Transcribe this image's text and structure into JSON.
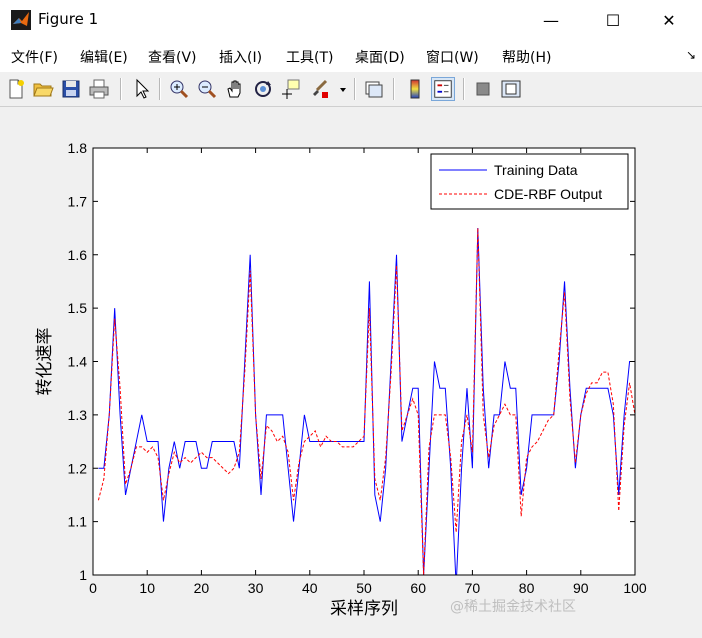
{
  "window": {
    "title": "Figure 1",
    "minimize_glyph": "—",
    "maximize_glyph": "☐",
    "close_glyph": "✕"
  },
  "menu": {
    "items": [
      "文件(F)",
      "编辑(E)",
      "查看(V)",
      "插入(I)",
      "工具(T)",
      "桌面(D)",
      "窗口(W)",
      "帮助(H)"
    ],
    "overflow_glyph": "↘"
  },
  "toolbar": {
    "icons": [
      "new-file-icon",
      "open-folder-icon",
      "save-icon",
      "print-icon",
      "pointer-icon",
      "zoom-in-icon",
      "zoom-out-icon",
      "pan-hand-icon",
      "rotate-3d-icon",
      "data-cursor-icon",
      "brush-icon",
      "brush-dropdown-icon",
      "link-plot-icon",
      "colorbar-icon",
      "legend-icon",
      "hide-plot-tools-icon",
      "show-plot-tools-icon"
    ]
  },
  "watermark": "@稀土掘金技术社区",
  "chart_data": {
    "type": "line",
    "title": "",
    "xlabel": "采样序列",
    "ylabel": "转化速率",
    "xlim": [
      0,
      100
    ],
    "ylim": [
      1,
      1.8
    ],
    "xticks": [
      0,
      10,
      20,
      30,
      40,
      50,
      60,
      70,
      80,
      90,
      100
    ],
    "yticks": [
      1,
      1.1,
      1.2,
      1.3,
      1.4,
      1.5,
      1.6,
      1.7,
      1.8
    ],
    "grid": false,
    "legend_position": "top-right",
    "series": [
      {
        "name": "Training Data",
        "color": "#0000ff",
        "style": "solid",
        "x": [
          1,
          2,
          3,
          4,
          5,
          6,
          7,
          8,
          9,
          10,
          11,
          12,
          13,
          14,
          15,
          16,
          17,
          18,
          19,
          20,
          21,
          22,
          23,
          24,
          25,
          26,
          27,
          28,
          29,
          30,
          31,
          32,
          33,
          34,
          35,
          36,
          37,
          38,
          39,
          40,
          41,
          42,
          43,
          44,
          45,
          46,
          47,
          48,
          49,
          50,
          51,
          52,
          53,
          54,
          55,
          56,
          57,
          58,
          59,
          60,
          61,
          62,
          63,
          64,
          65,
          66,
          67,
          68,
          69,
          70,
          71,
          72,
          73,
          74,
          75,
          76,
          77,
          78,
          79,
          80,
          81,
          82,
          83,
          84,
          85,
          86,
          87,
          88,
          89,
          90,
          91,
          92,
          93,
          94,
          95,
          96,
          97,
          98,
          99,
          100
        ],
        "y": [
          1.2,
          1.2,
          1.3,
          1.5,
          1.3,
          1.15,
          1.2,
          1.25,
          1.3,
          1.25,
          1.25,
          1.25,
          1.1,
          1.2,
          1.25,
          1.2,
          1.25,
          1.25,
          1.25,
          1.2,
          1.2,
          1.25,
          1.25,
          1.25,
          1.25,
          1.25,
          1.2,
          1.4,
          1.6,
          1.3,
          1.15,
          1.3,
          1.3,
          1.3,
          1.3,
          1.2,
          1.1,
          1.2,
          1.3,
          1.25,
          1.25,
          1.25,
          1.25,
          1.25,
          1.25,
          1.25,
          1.25,
          1.25,
          1.25,
          1.25,
          1.55,
          1.15,
          1.1,
          1.2,
          1.4,
          1.6,
          1.25,
          1.3,
          1.35,
          1.35,
          1.0,
          1.2,
          1.4,
          1.35,
          1.35,
          1.2,
          0.98,
          1.2,
          1.35,
          1.2,
          1.65,
          1.35,
          1.2,
          1.3,
          1.3,
          1.4,
          1.35,
          1.35,
          1.15,
          1.2,
          1.3,
          1.3,
          1.3,
          1.3,
          1.3,
          1.4,
          1.55,
          1.35,
          1.2,
          1.3,
          1.35,
          1.35,
          1.35,
          1.35,
          1.35,
          1.3,
          1.15,
          1.3,
          1.4,
          1.4
        ]
      },
      {
        "name": "CDE-RBF Output",
        "color": "#ff0000",
        "style": "dashed",
        "x": [
          1,
          2,
          3,
          4,
          5,
          6,
          7,
          8,
          9,
          10,
          11,
          12,
          13,
          14,
          15,
          16,
          17,
          18,
          19,
          20,
          21,
          22,
          23,
          24,
          25,
          26,
          27,
          28,
          29,
          30,
          31,
          32,
          33,
          34,
          35,
          36,
          37,
          38,
          39,
          40,
          41,
          42,
          43,
          44,
          45,
          46,
          47,
          48,
          49,
          50,
          51,
          52,
          53,
          54,
          55,
          56,
          57,
          58,
          59,
          60,
          61,
          62,
          63,
          64,
          65,
          66,
          67,
          68,
          69,
          70,
          71,
          72,
          73,
          74,
          75,
          76,
          77,
          78,
          79,
          80,
          81,
          82,
          83,
          84,
          85,
          86,
          87,
          88,
          89,
          90,
          91,
          92,
          93,
          94,
          95,
          96,
          97,
          98,
          99,
          100
        ],
        "y": [
          1.14,
          1.18,
          1.3,
          1.48,
          1.35,
          1.17,
          1.2,
          1.24,
          1.24,
          1.23,
          1.24,
          1.22,
          1.14,
          1.19,
          1.23,
          1.21,
          1.22,
          1.21,
          1.22,
          1.23,
          1.22,
          1.22,
          1.21,
          1.2,
          1.19,
          1.2,
          1.23,
          1.38,
          1.57,
          1.3,
          1.18,
          1.28,
          1.27,
          1.25,
          1.26,
          1.23,
          1.14,
          1.21,
          1.25,
          1.26,
          1.27,
          1.24,
          1.26,
          1.25,
          1.25,
          1.24,
          1.24,
          1.24,
          1.25,
          1.26,
          1.5,
          1.18,
          1.14,
          1.22,
          1.38,
          1.58,
          1.27,
          1.3,
          1.33,
          1.3,
          1.0,
          1.24,
          1.3,
          1.3,
          1.3,
          1.22,
          1.08,
          1.25,
          1.3,
          1.23,
          1.65,
          1.3,
          1.22,
          1.28,
          1.3,
          1.32,
          1.3,
          1.3,
          1.11,
          1.22,
          1.24,
          1.25,
          1.27,
          1.29,
          1.3,
          1.42,
          1.53,
          1.33,
          1.21,
          1.3,
          1.34,
          1.36,
          1.36,
          1.38,
          1.38,
          1.32,
          1.12,
          1.28,
          1.36,
          1.3
        ]
      }
    ]
  }
}
